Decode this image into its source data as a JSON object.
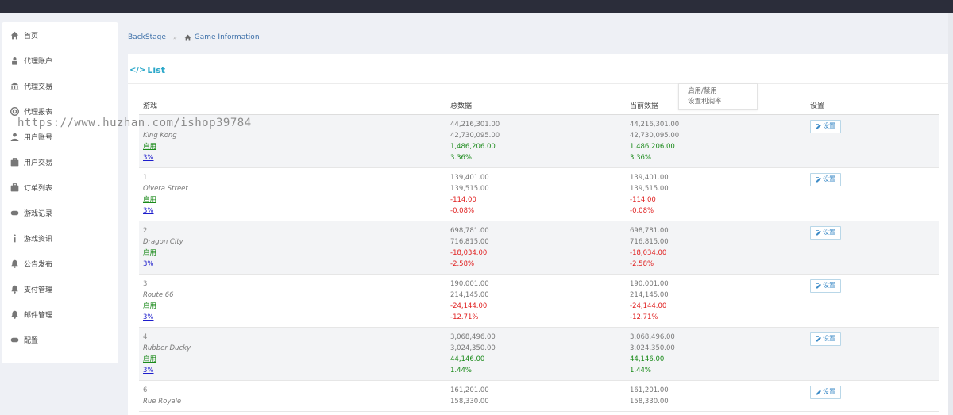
{
  "sidebar": {
    "items": [
      {
        "label": "首页",
        "icon": "home-icon"
      },
      {
        "label": "代理账户",
        "icon": "user-lock-icon"
      },
      {
        "label": "代理交易",
        "icon": "bank-icon"
      },
      {
        "label": "代理报表",
        "icon": "lifebuoy-icon"
      },
      {
        "label": "用户账号",
        "icon": "user-icon"
      },
      {
        "label": "用户交易",
        "icon": "briefcase-icon"
      },
      {
        "label": "订单列表",
        "icon": "briefcase-icon"
      },
      {
        "label": "游戏记录",
        "icon": "gamepad-icon"
      },
      {
        "label": "游戏资讯",
        "icon": "info-icon"
      },
      {
        "label": "公告发布",
        "icon": "bell-icon"
      },
      {
        "label": "支付管理",
        "icon": "bell-icon"
      },
      {
        "label": "邮件管理",
        "icon": "bell-icon"
      },
      {
        "label": "配置",
        "icon": "gamepad-icon"
      }
    ]
  },
  "watermark": "https://www.huzhan.com/ishop39784",
  "breadcrumb": {
    "root": "BackStage",
    "current": "Game Information"
  },
  "panel": {
    "title": "List"
  },
  "table": {
    "headers": {
      "game": "游戏",
      "total": "总数据",
      "current": "当前数据",
      "settings": "设置"
    },
    "rows": [
      {
        "id": "",
        "name": "King Kong",
        "status": "启用",
        "rate": "3%",
        "total": [
          "44,216,301.00",
          "42,730,095.00",
          "1,486,206.00",
          "3.36%"
        ],
        "current": [
          "44,216,301.00",
          "42,730,095.00",
          "1,486,206.00",
          "3.36%"
        ],
        "positive": true
      },
      {
        "id": "1",
        "name": "Olvera Street",
        "status": "启用",
        "rate": "3%",
        "total": [
          "139,401.00",
          "139,515.00",
          "-114.00",
          "-0.08%"
        ],
        "current": [
          "139,401.00",
          "139,515.00",
          "-114.00",
          "-0.08%"
        ],
        "positive": false
      },
      {
        "id": "2",
        "name": "Dragon City",
        "status": "启用",
        "rate": "3%",
        "total": [
          "698,781.00",
          "716,815.00",
          "-18,034.00",
          "-2.58%"
        ],
        "current": [
          "698,781.00",
          "716,815.00",
          "-18,034.00",
          "-2.58%"
        ],
        "positive": false
      },
      {
        "id": "3",
        "name": "Route 66",
        "status": "启用",
        "rate": "3%",
        "total": [
          "190,001.00",
          "214,145.00",
          "-24,144.00",
          "-12.71%"
        ],
        "current": [
          "190,001.00",
          "214,145.00",
          "-24,144.00",
          "-12.71%"
        ],
        "positive": false
      },
      {
        "id": "4",
        "name": "Rubber Ducky",
        "status": "启用",
        "rate": "3%",
        "total": [
          "3,068,496.00",
          "3,024,350.00",
          "44,146.00",
          "1.44%"
        ],
        "current": [
          "3,068,496.00",
          "3,024,350.00",
          "44,146.00",
          "1.44%"
        ],
        "positive": true
      },
      {
        "id": "6",
        "name": "Rue Royale",
        "status": "",
        "rate": "",
        "total": [
          "161,201.00",
          "158,330.00",
          "",
          ""
        ],
        "current": [
          "161,201.00",
          "158,330.00",
          "",
          ""
        ],
        "positive": true
      }
    ],
    "set_label": "设置"
  },
  "dropdown": {
    "items": [
      "启用/禁用",
      "设置利润率"
    ]
  },
  "colors": {
    "accent": "#2aa7c9",
    "positive": "#1a8a1a",
    "negative": "#e02020",
    "link": "#1d1dcc",
    "topbar": "#2b2d3a"
  }
}
